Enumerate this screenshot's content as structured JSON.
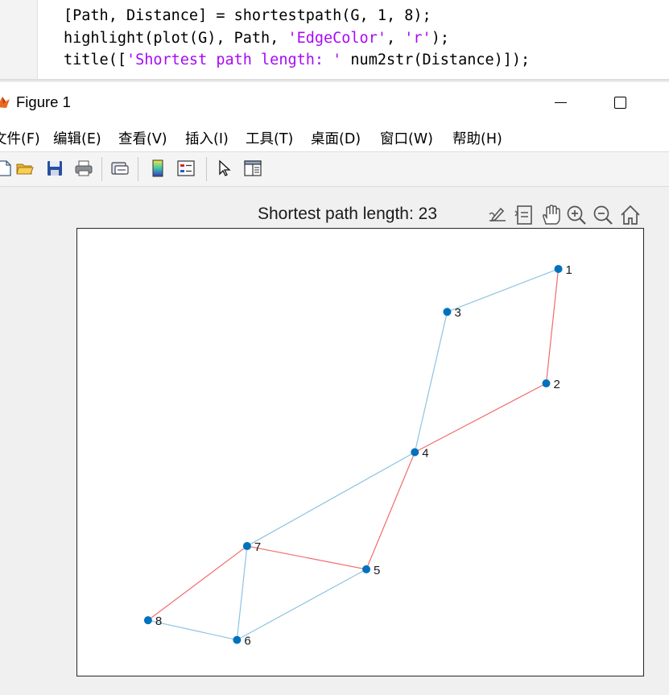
{
  "editor": {
    "lines": [
      {
        "parts": [
          {
            "t": "[Path, Distance] = shortestpath(G, 1, 8);",
            "s": false
          }
        ]
      },
      {
        "parts": [
          {
            "t": "highlight(plot(G), Path, ",
            "s": false
          },
          {
            "t": "'EdgeColor'",
            "s": true
          },
          {
            "t": ", ",
            "s": false
          },
          {
            "t": "'r'",
            "s": true
          },
          {
            "t": ");",
            "s": false
          }
        ]
      },
      {
        "parts": [
          {
            "t": "title([",
            "s": false
          },
          {
            "t": "'Shortest path length: '",
            "s": true
          },
          {
            "t": " num2str(Distance)]);",
            "s": false
          }
        ]
      }
    ]
  },
  "window": {
    "title": "Figure 1",
    "app_icon": "matlab-icon",
    "min_icon": "minimize-icon",
    "max_icon": "maximize-icon"
  },
  "menu": [
    "文件(F)",
    "编辑(E)",
    "查看(V)",
    "插入(I)",
    "工具(T)",
    "桌面(D)",
    "窗口(W)",
    "帮助(H)"
  ],
  "toolbar": {
    "icons": [
      "new-file-icon",
      "open-folder-icon",
      "save-icon",
      "print-icon",
      "link-figure-icon",
      "colorbar-icon",
      "legend-icon",
      "pointer-icon",
      "property-inspector-icon"
    ]
  },
  "axes": {
    "title": "Shortest path length: 23",
    "tools": [
      "edit-plot-icon",
      "data-tips-icon",
      "pan-icon",
      "zoom-in-icon",
      "zoom-out-icon",
      "home-icon"
    ]
  },
  "colors": {
    "node": "#0072bd",
    "edge": "#8ec3e0",
    "highlight": "#f26b6b",
    "string": "#a709f5"
  },
  "chart_data": {
    "type": "graph",
    "title": "Shortest path length: 23",
    "path": [
      1,
      2,
      4,
      5,
      7,
      8
    ],
    "distance": 23,
    "nodes": [
      {
        "id": "1",
        "label": "1",
        "x": 2.88,
        "y": 3.15
      },
      {
        "id": "2",
        "label": "2",
        "x": 2.82,
        "y": 1.87
      },
      {
        "id": "3",
        "label": "3",
        "x": 2.33,
        "y": 2.67
      },
      {
        "id": "4",
        "label": "4",
        "x": 2.17,
        "y": 1.1
      },
      {
        "id": "5",
        "label": "5",
        "x": 1.93,
        "y": -0.21
      },
      {
        "id": "6",
        "label": "6",
        "x": 1.29,
        "y": -1.0
      },
      {
        "id": "7",
        "label": "7",
        "x": 1.34,
        "y": 0.05
      },
      {
        "id": "8",
        "label": "8",
        "x": 0.85,
        "y": -0.78
      }
    ],
    "edges": [
      {
        "source": "1",
        "target": "3",
        "highlighted": false
      },
      {
        "source": "1",
        "target": "2",
        "highlighted": true
      },
      {
        "source": "3",
        "target": "4",
        "highlighted": false
      },
      {
        "source": "2",
        "target": "4",
        "highlighted": true
      },
      {
        "source": "4",
        "target": "7",
        "highlighted": false
      },
      {
        "source": "4",
        "target": "5",
        "highlighted": true
      },
      {
        "source": "7",
        "target": "5",
        "highlighted": true
      },
      {
        "source": "7",
        "target": "8",
        "highlighted": true
      },
      {
        "source": "7",
        "target": "6",
        "highlighted": false
      },
      {
        "source": "5",
        "target": "6",
        "highlighted": false
      },
      {
        "source": "8",
        "target": "6",
        "highlighted": false
      }
    ],
    "xlim": [
      0.5,
      3.3
    ],
    "ylim": [
      -1.4,
      3.6
    ]
  }
}
